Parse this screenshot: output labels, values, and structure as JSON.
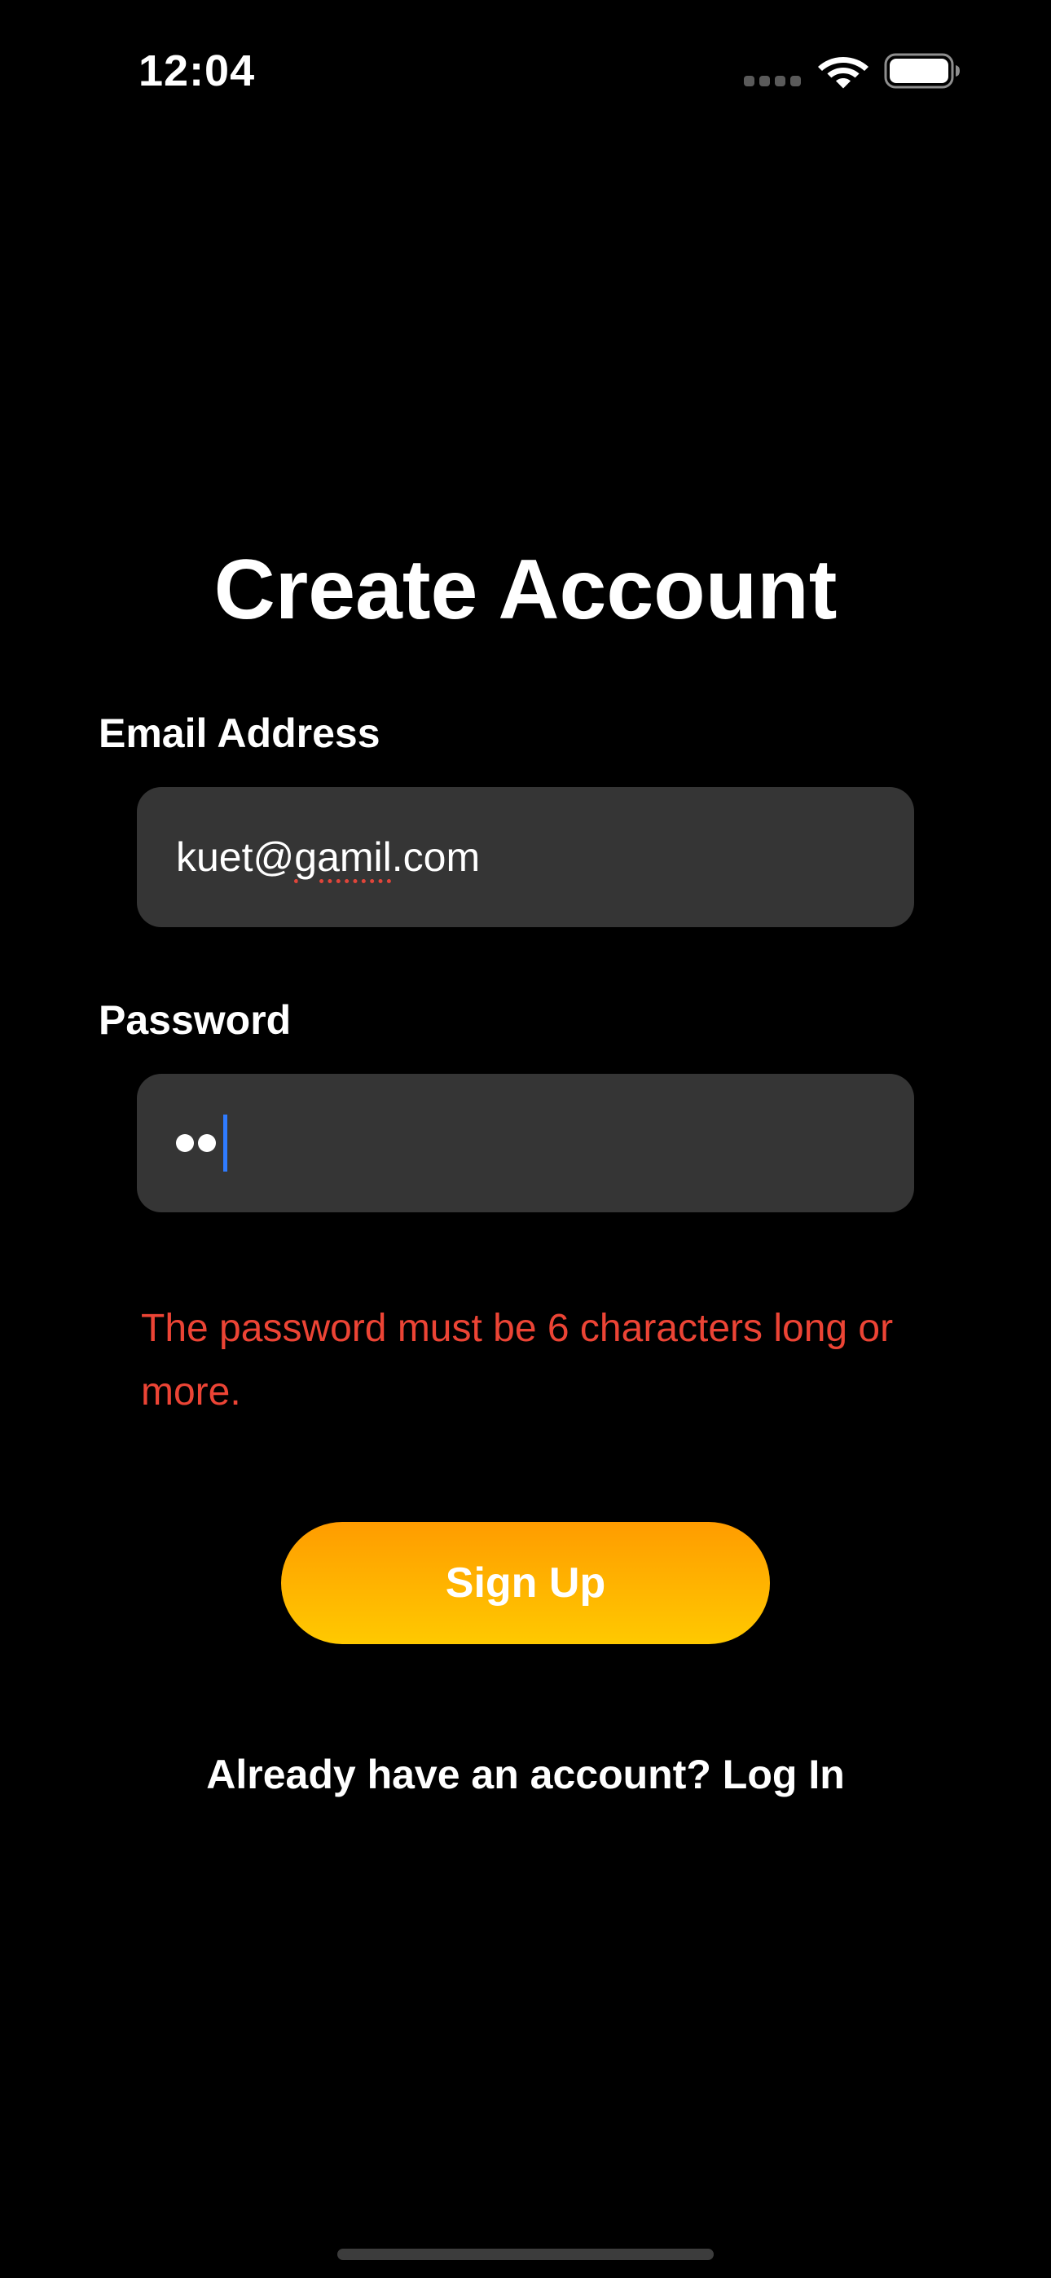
{
  "status_bar": {
    "time": "12:04",
    "icons": [
      "cellular-signal-icon",
      "wifi-icon",
      "battery-icon"
    ]
  },
  "page": {
    "title": "Create Account"
  },
  "email": {
    "label": "Email Address",
    "value_before": "kuet@",
    "value_misspelled": "gamil",
    "value_after": ".com"
  },
  "password": {
    "label": "Password",
    "masked_char_count": 2
  },
  "error": {
    "message": "The password must be 6 characters long or more."
  },
  "actions": {
    "signup_label": "Sign Up",
    "login_prompt": "Already have an account? Log In"
  },
  "colors": {
    "background": "#000000",
    "field_background": "#353535",
    "error": "#ec4435",
    "button_gradient_top": "#ff9c00",
    "button_gradient_bottom": "#ffc900",
    "caret": "#2f7bff"
  }
}
